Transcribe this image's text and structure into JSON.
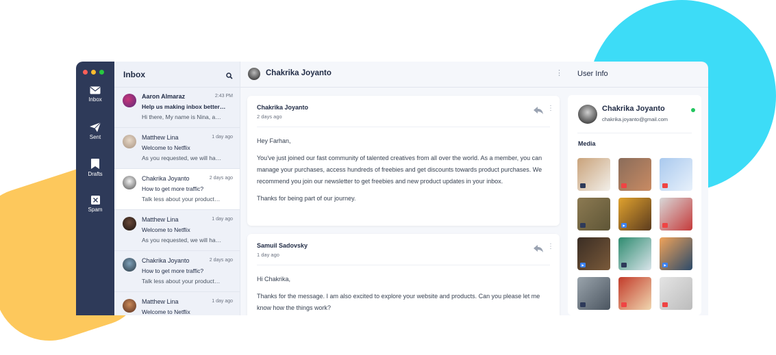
{
  "colors": {
    "sidebar": "#2e3a59",
    "accent_blue": "#3ddcf7",
    "accent_yellow": "#fdc85c",
    "online": "#22c55e"
  },
  "sidebar": {
    "window_dots": [
      "#ff5f57",
      "#febc2e",
      "#28c840"
    ],
    "items": [
      {
        "label": "Inbox",
        "icon": "envelope-icon"
      },
      {
        "label": "Sent",
        "icon": "paper-plane-icon"
      },
      {
        "label": "Drafts",
        "icon": "bookmark-icon"
      },
      {
        "label": "Spam",
        "icon": "spam-x-icon"
      }
    ]
  },
  "inbox": {
    "title": "Inbox",
    "search_icon": "search-icon",
    "mails": [
      {
        "name": "Aaron Almaraz",
        "time": "2:43 PM",
        "subject": "Help us making inbox better…",
        "preview": "Hi there, My name is Nina, a…",
        "unread": true
      },
      {
        "name": "Matthew Lina",
        "time": "1 day ago",
        "subject": "Welcome to Netflix",
        "preview": "As you requested, we will ha…",
        "unread": false
      },
      {
        "name": "Chakrika Joyanto",
        "time": "2 days ago",
        "subject": "How to get more traffic?",
        "preview": "Talk less about your product…",
        "unread": false
      },
      {
        "name": "Matthew Lina",
        "time": "1 day ago",
        "subject": "Welcome to Netflix",
        "preview": "As you requested, we will ha…",
        "unread": false
      },
      {
        "name": "Chakrika Joyanto",
        "time": "2 days ago",
        "subject": "How to get more traffic?",
        "preview": "Talk less about your product…",
        "unread": false
      },
      {
        "name": "Matthew Lina",
        "time": "1 day ago",
        "subject": "Welcome to Netflix",
        "preview": "",
        "unread": false
      }
    ]
  },
  "thread": {
    "title": "Chakrika Joyanto",
    "messages": [
      {
        "from": "Chakrika Joyanto",
        "ago": "2 days ago",
        "paragraphs": [
          "Hey Farhan,",
          "You've just joined our fast community of talented creatives from all over the world. As a member, you can manage your purchases, access hundreds of freebies and get discounts towards product purchases. We recommend you join our newsletter to get freebies and new product updates in your inbox.",
          "Thanks for being part of our journey."
        ]
      },
      {
        "from": "Samuil Sadovsky",
        "ago": "1 day ago",
        "paragraphs": [
          "Hi Chakrika,",
          "Thanks for the message. I am also excited to explore your website and products. Can you please let me know how the things work?"
        ]
      }
    ]
  },
  "user_info": {
    "title": "User Info",
    "name": "Chakrika Joyanto",
    "email": "chakrika.joyanto@gmail.com",
    "media_label": "Media",
    "media": [
      {
        "type": "img",
        "colors": [
          "#c9a27a",
          "#f2efe9"
        ]
      },
      {
        "type": "pdf",
        "colors": [
          "#8a6c5a",
          "#c98b63"
        ]
      },
      {
        "type": "pdf",
        "colors": [
          "#a9c9ee",
          "#e8f1fb"
        ]
      },
      {
        "type": "img",
        "colors": [
          "#8c7a52",
          "#5e5536"
        ]
      },
      {
        "type": "vid",
        "colors": [
          "#e0a22e",
          "#5b3b1e"
        ]
      },
      {
        "type": "pdf",
        "colors": [
          "#d8d8d8",
          "#c53a3a"
        ]
      },
      {
        "type": "vid",
        "colors": [
          "#3a2d24",
          "#7a5a3a"
        ]
      },
      {
        "type": "img",
        "colors": [
          "#2e8b6f",
          "#d9e4ea"
        ]
      },
      {
        "type": "vid",
        "colors": [
          "#f0a35a",
          "#2b4a6a"
        ]
      },
      {
        "type": "img",
        "colors": [
          "#9aa4ac",
          "#4b5560"
        ]
      },
      {
        "type": "pdf",
        "colors": [
          "#c23b2a",
          "#f0d7b0"
        ]
      },
      {
        "type": "pdf",
        "colors": [
          "#e4e4e4",
          "#bcbcbc"
        ]
      }
    ]
  }
}
